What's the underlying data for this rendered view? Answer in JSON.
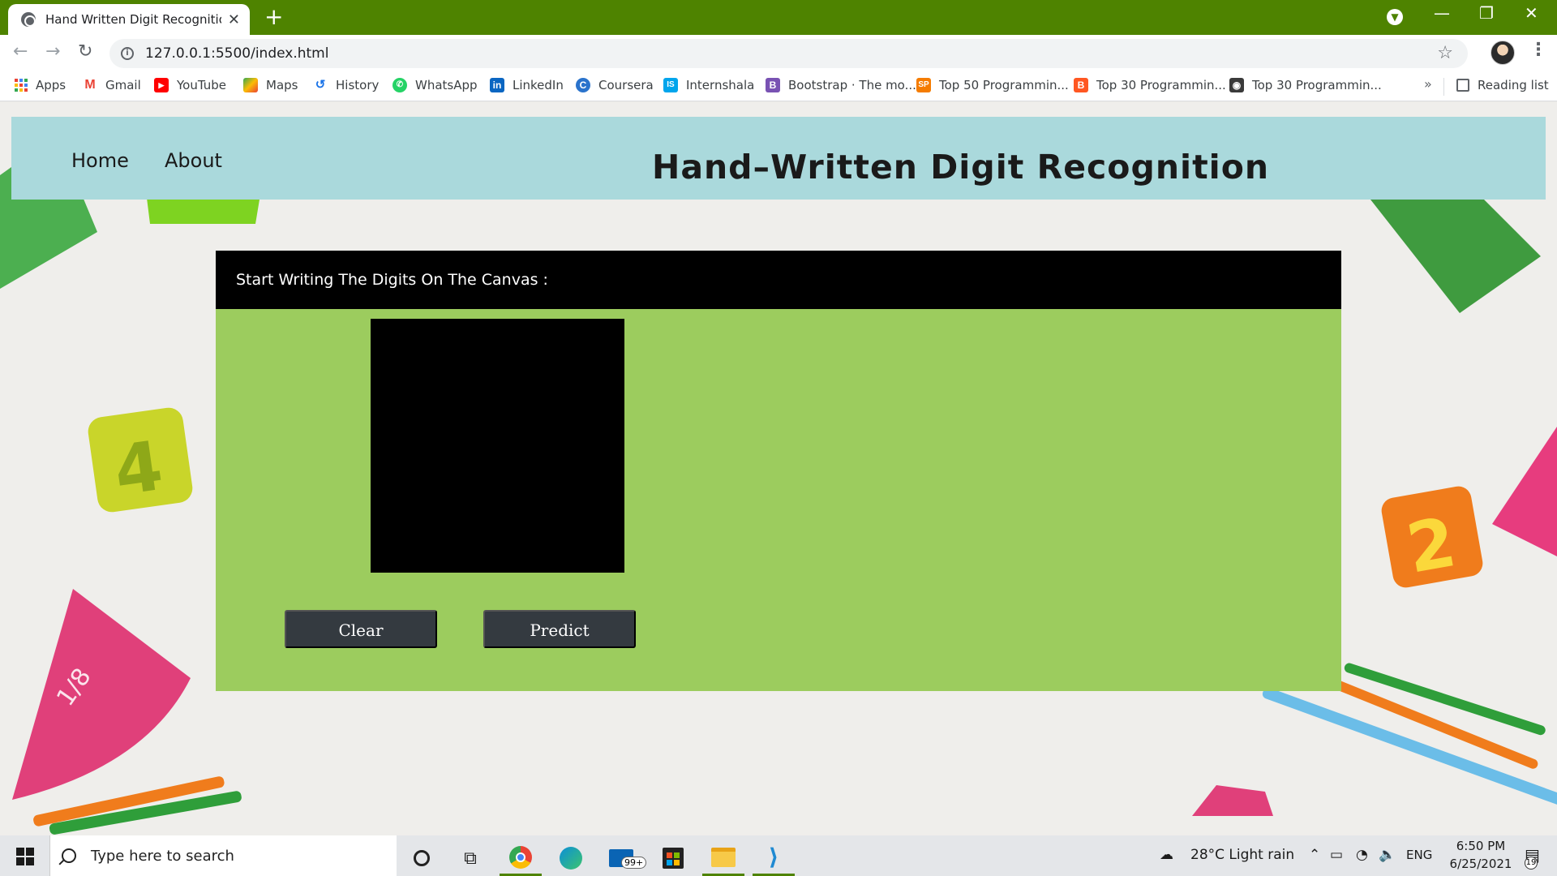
{
  "browser": {
    "tab_title": "Hand Written Digit Recognition u",
    "url": "127.0.0.1:5500/index.html",
    "bookmarks": [
      {
        "label": "Apps",
        "icon": "apps-grid-icon",
        "color": "#ea4335"
      },
      {
        "label": "Gmail",
        "icon": "gmail-icon",
        "color": "#ea4335"
      },
      {
        "label": "YouTube",
        "icon": "youtube-icon",
        "color": "#ff0000"
      },
      {
        "label": "Maps",
        "icon": "maps-icon",
        "color": "#34a853"
      },
      {
        "label": "History",
        "icon": "history-icon",
        "color": "#1a73e8"
      },
      {
        "label": "WhatsApp",
        "icon": "whatsapp-icon",
        "color": "#25d366"
      },
      {
        "label": "LinkedIn",
        "icon": "linkedin-icon",
        "color": "#0a66c2"
      },
      {
        "label": "Coursera",
        "icon": "coursera-icon",
        "color": "#2a73cc"
      },
      {
        "label": "Internshala",
        "icon": "internshala-icon",
        "color": "#00a5ec"
      },
      {
        "label": "Bootstrap · The mo...",
        "icon": "bootstrap-icon",
        "color": "#7952b3"
      },
      {
        "label": "Top 50 Programmin...",
        "icon": "sp-icon",
        "color": "#f57c00"
      },
      {
        "label": "Top 30 Programmin...",
        "icon": "blogger-icon",
        "color": "#ff5722"
      },
      {
        "label": "Top 30 Programmin...",
        "icon": "site-icon",
        "color": "#3a3a3a"
      }
    ],
    "reading_list": "Reading list",
    "more": "»"
  },
  "site": {
    "nav": {
      "home": "Home",
      "about": "About"
    },
    "title": "Hand–Written Digit Recognition",
    "panel_heading": "Start Writing The Digits On The Canvas :",
    "clear_button": "Clear",
    "predict_button": "Predict"
  },
  "taskbar": {
    "search_placeholder": "Type here to search",
    "weather": "28°C  Light rain",
    "language": "ENG",
    "time": "6:50 PM",
    "date": "6/25/2021",
    "mail_badge": "99+",
    "notification_count": "19"
  }
}
